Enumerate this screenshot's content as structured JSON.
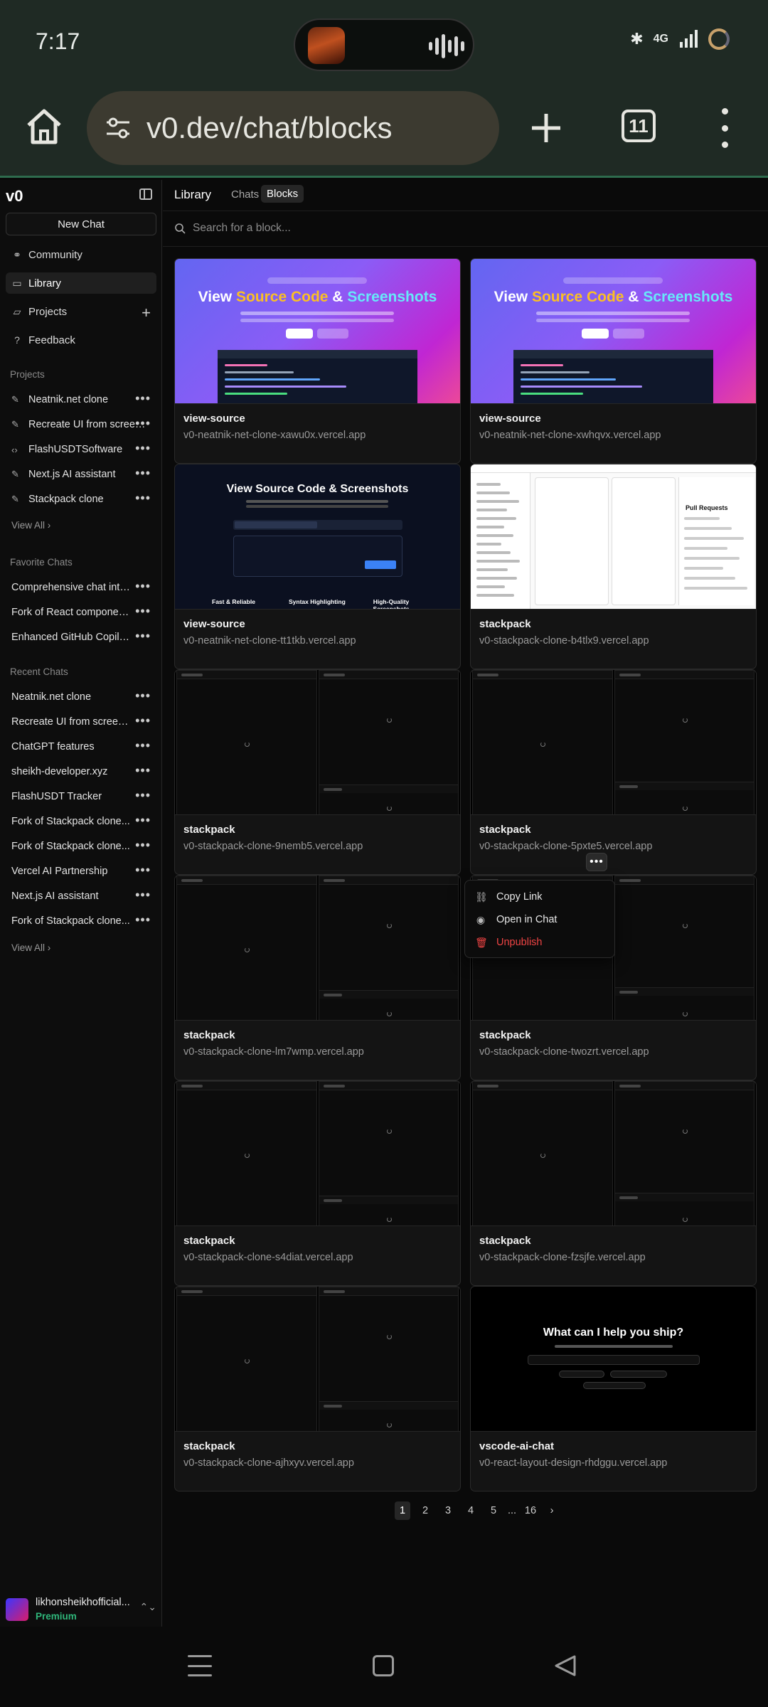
{
  "status_bar": {
    "time": "7:17",
    "network": "4G",
    "icons": [
      "bluetooth-icon",
      "vibrate-icon",
      "signal-icon",
      "battery-icon"
    ]
  },
  "browser": {
    "url": "v0.dev/chat/blocks",
    "tab_count": "11"
  },
  "sidebar": {
    "logo": "v0",
    "new_chat": "New Chat",
    "nav": [
      {
        "label": "Community",
        "icon": "community-icon"
      },
      {
        "label": "Library",
        "icon": "library-icon",
        "active": true
      },
      {
        "label": "Projects",
        "icon": "folder-icon"
      },
      {
        "label": "Feedback",
        "icon": "feedback-icon"
      }
    ],
    "projects_heading": "Projects",
    "projects": [
      {
        "label": "Neatnik.net clone",
        "icon": "sparkle-icon"
      },
      {
        "label": "Recreate UI from screenshot",
        "icon": "sparkle-icon"
      },
      {
        "label": "FlashUSDTSoftware",
        "icon": "code-icon"
      },
      {
        "label": "Next.js AI assistant",
        "icon": "sparkle-icon"
      },
      {
        "label": "Stackpack clone",
        "icon": "sparkle-icon"
      }
    ],
    "view_all": "View All",
    "favorites_heading": "Favorite Chats",
    "favorites": [
      "Comprehensive chat interface",
      "Fork of React component code",
      "Enhanced GitHub Copilot clone"
    ],
    "recent_heading": "Recent Chats",
    "recent": [
      "Neatnik.net clone",
      "Recreate UI from screenshot",
      "ChatGPT features",
      "sheikh-developer.xyz",
      "FlashUSDT Tracker",
      "Fork of Stackpack clone...",
      "Fork of Stackpack clone...",
      "Vercel AI Partnership",
      "Next.js AI assistant",
      "Fork of Stackpack clone..."
    ],
    "account": {
      "name": "likhonsheikhofficial...",
      "plan": "Premium"
    }
  },
  "main": {
    "title": "Library",
    "tabs": [
      {
        "label": "Chats"
      },
      {
        "label": "Blocks",
        "active": true
      }
    ],
    "search_placeholder": "Search for a block...",
    "cards": [
      {
        "title": "view-source",
        "url": "v0-neatnik-net-clone-xawu0x.vercel.app",
        "preview": "gradient"
      },
      {
        "title": "view-source",
        "url": "v0-neatnik-net-clone-xwhqvx.vercel.app",
        "preview": "gradient"
      },
      {
        "title": "view-source",
        "url": "v0-neatnik-net-clone-tt1tkb.vercel.app",
        "preview": "dark"
      },
      {
        "title": "stackpack",
        "url": "v0-stackpack-clone-b4tlx9.vercel.app",
        "preview": "light"
      },
      {
        "title": "stackpack",
        "url": "v0-stackpack-clone-9nemb5.vercel.app",
        "preview": "split"
      },
      {
        "title": "stackpack",
        "url": "v0-stackpack-clone-5pxte5.vercel.app",
        "preview": "split"
      },
      {
        "title": "stackpack",
        "url": "v0-stackpack-clone-lm7wmp.vercel.app",
        "preview": "split"
      },
      {
        "title": "stackpack",
        "url": "v0-stackpack-clone-twozrt.vercel.app",
        "preview": "split"
      },
      {
        "title": "stackpack",
        "url": "v0-stackpack-clone-s4diat.vercel.app",
        "preview": "split"
      },
      {
        "title": "stackpack",
        "url": "v0-stackpack-clone-fzsjfe.vercel.app",
        "preview": "split"
      },
      {
        "title": "stackpack",
        "url": "v0-stackpack-clone-ajhxyv.vercel.app",
        "preview": "split"
      },
      {
        "title": "vscode-ai-chat",
        "url": "v0-react-layout-design-rhdggu.vercel.app",
        "preview": "chat"
      }
    ],
    "previews": {
      "gradient_heading": [
        "View ",
        "Source Code",
        " & ",
        "Screenshots"
      ],
      "dark_heading": "View Source Code & Screenshots",
      "dark_features": [
        "Fast & Reliable",
        "Syntax Highlighting",
        "High-Quality Screenshots"
      ],
      "light_heading": "Pull Requests",
      "chat_heading": "What can I help you ship?"
    },
    "context_menu": [
      {
        "label": "Copy Link",
        "icon": "link-icon"
      },
      {
        "label": "Open in Chat",
        "icon": "eye-icon"
      },
      {
        "label": "Unpublish",
        "icon": "trash-icon",
        "danger": true
      }
    ],
    "pagination": {
      "pages": [
        "1",
        "2",
        "3",
        "4",
        "5"
      ],
      "ellipsis": "...",
      "last": "16",
      "current": "1"
    }
  },
  "colors": {
    "accent_green": "#2fb67a",
    "danger": "#ef4444",
    "browser_chrome": "#1f2a24"
  }
}
